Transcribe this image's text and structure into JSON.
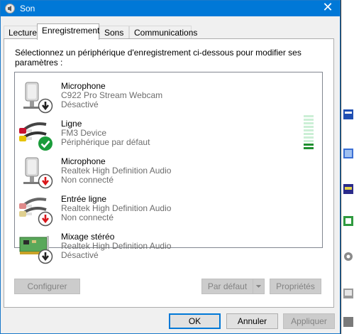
{
  "window": {
    "title": "Son",
    "close_glyph": "✕"
  },
  "tabs": [
    {
      "label": "Lecture",
      "active": false
    },
    {
      "label": "Enregistrement",
      "active": true
    },
    {
      "label": "Sons",
      "active": false
    },
    {
      "label": "Communications",
      "active": false
    }
  ],
  "instruction": "Sélectionnez un périphérique d'enregistrement ci-dessous pour modifier ses paramètres :",
  "devices": [
    {
      "name": "Microphone",
      "description": "C922 Pro Stream Webcam",
      "status": "Désactivé",
      "icon": "microphone-icon",
      "badge": "disabled-badge-icon"
    },
    {
      "name": "Ligne",
      "description": "FM3 Device",
      "status": "Périphérique par défaut",
      "icon": "line-in-cable-icon",
      "badge": "default-check-icon"
    },
    {
      "name": "Microphone",
      "description": "Realtek High Definition Audio",
      "status": "Non connecté",
      "icon": "microphone-icon",
      "badge": "not-connected-badge-icon"
    },
    {
      "name": "Entrée ligne",
      "description": "Realtek High Definition Audio",
      "status": "Non connecté",
      "icon": "line-in-cable-icon",
      "badge": "not-connected-badge-icon"
    },
    {
      "name": "Mixage stéréo",
      "description": "Realtek High Definition Audio",
      "status": "Désactivé",
      "icon": "sound-card-icon",
      "badge": "disabled-badge-icon"
    }
  ],
  "level_meter": {
    "segments": 10,
    "lit": 2
  },
  "buttons": {
    "configure": "Configurer",
    "set_default": "Par défaut",
    "properties": "Propriétés",
    "ok": "OK",
    "cancel": "Annuler",
    "apply": "Appliquer"
  },
  "colors": {
    "titlebar": "#0078d7",
    "default_check": "#1a9c3a",
    "not_connected": "#d9161a"
  }
}
